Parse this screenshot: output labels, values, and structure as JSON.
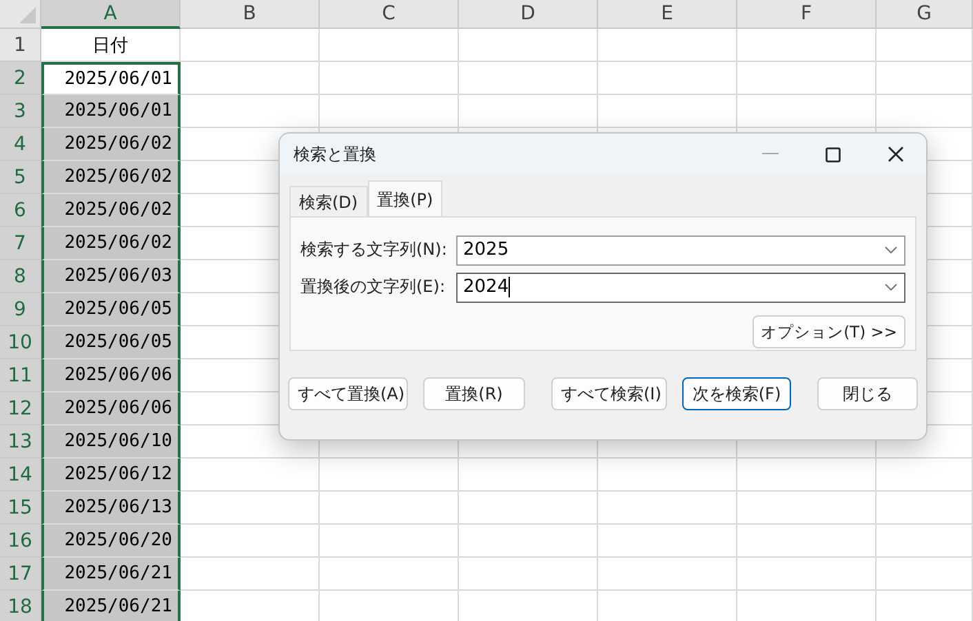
{
  "sheet": {
    "columns": [
      {
        "label": "A",
        "selected": true
      },
      {
        "label": "B",
        "selected": false
      },
      {
        "label": "C",
        "selected": false
      },
      {
        "label": "D",
        "selected": false
      },
      {
        "label": "E",
        "selected": false
      },
      {
        "label": "F",
        "selected": false
      },
      {
        "label": "G",
        "selected": false
      }
    ],
    "rows": [
      {
        "number": "1",
        "value": "日付",
        "kind": "text",
        "selected": false,
        "active": false
      },
      {
        "number": "2",
        "value": "2025/06/01",
        "kind": "date",
        "selected": true,
        "active": true
      },
      {
        "number": "3",
        "value": "2025/06/01",
        "kind": "date",
        "selected": true,
        "active": false
      },
      {
        "number": "4",
        "value": "2025/06/02",
        "kind": "date",
        "selected": true,
        "active": false
      },
      {
        "number": "5",
        "value": "2025/06/02",
        "kind": "date",
        "selected": true,
        "active": false
      },
      {
        "number": "6",
        "value": "2025/06/02",
        "kind": "date",
        "selected": true,
        "active": false
      },
      {
        "number": "7",
        "value": "2025/06/02",
        "kind": "date",
        "selected": true,
        "active": false
      },
      {
        "number": "8",
        "value": "2025/06/03",
        "kind": "date",
        "selected": true,
        "active": false
      },
      {
        "number": "9",
        "value": "2025/06/05",
        "kind": "date",
        "selected": true,
        "active": false
      },
      {
        "number": "10",
        "value": "2025/06/05",
        "kind": "date",
        "selected": true,
        "active": false
      },
      {
        "number": "11",
        "value": "2025/06/06",
        "kind": "date",
        "selected": true,
        "active": false
      },
      {
        "number": "12",
        "value": "2025/06/06",
        "kind": "date",
        "selected": true,
        "active": false
      },
      {
        "number": "13",
        "value": "2025/06/10",
        "kind": "date",
        "selected": true,
        "active": false
      },
      {
        "number": "14",
        "value": "2025/06/12",
        "kind": "date",
        "selected": true,
        "active": false
      },
      {
        "number": "15",
        "value": "2025/06/13",
        "kind": "date",
        "selected": true,
        "active": false
      },
      {
        "number": "16",
        "value": "2025/06/20",
        "kind": "date",
        "selected": true,
        "active": false
      },
      {
        "number": "17",
        "value": "2025/06/21",
        "kind": "date",
        "selected": true,
        "active": false
      },
      {
        "number": "18",
        "value": "2025/06/21",
        "kind": "date",
        "selected": true,
        "active": false
      }
    ]
  },
  "dialog": {
    "title": "検索と置換",
    "tabs": [
      {
        "label": "検索(D)",
        "selected": false
      },
      {
        "label": "置換(P)",
        "selected": true
      }
    ],
    "fields": [
      {
        "label": "検索する文字列(N):",
        "value": "2025",
        "focused": false
      },
      {
        "label": "置換後の文字列(E):",
        "value": "2024",
        "focused": true
      }
    ],
    "options_button": "オプション(T) >>",
    "buttons": [
      {
        "label": "すべて置換(A)",
        "default": false
      },
      {
        "label": "置換(R)",
        "default": false
      },
      {
        "label": "すべて検索(I)",
        "default": false
      },
      {
        "label": "次を検索(F)",
        "default": true
      },
      {
        "label": "閉じる",
        "default": false
      }
    ]
  }
}
